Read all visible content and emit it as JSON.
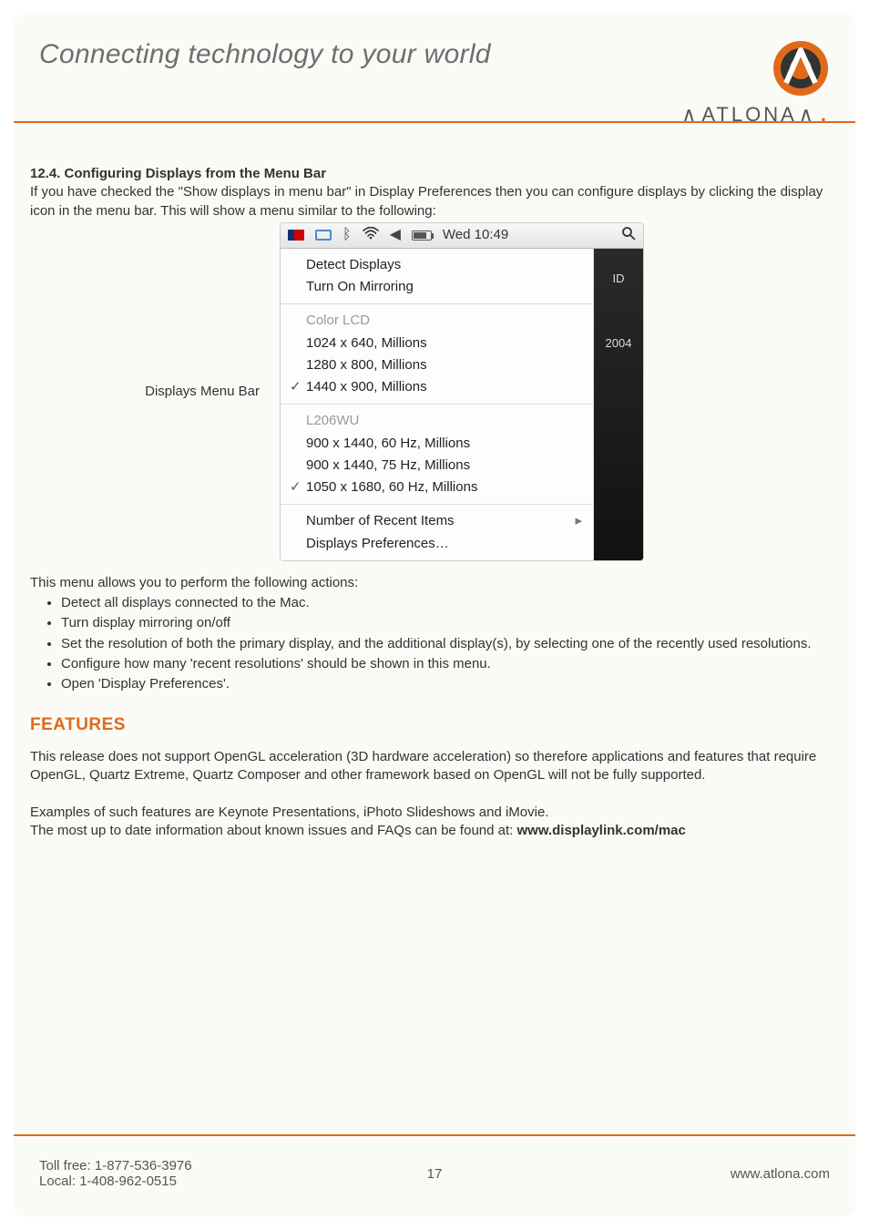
{
  "header": {
    "tagline": "Connecting technology to your world",
    "brand_word": "ATLONA",
    "brand_dot": "."
  },
  "section": {
    "number": "12.4.",
    "title": "Configuring Displays from the Menu Bar",
    "intro": "If you have checked the \"Show displays in menu bar\" in Display Preferences then you can configure displays by clicking the display icon in the menu bar. This will show a menu similar to the following:",
    "figure_caption": "Displays Menu Bar"
  },
  "screenshot": {
    "menubar": {
      "clock": "Wed 10:49"
    },
    "right_labels": {
      "a": "ID",
      "b": "2004"
    },
    "groups": {
      "actions": {
        "detect": "Detect Displays",
        "mirror": "Turn On Mirroring"
      },
      "display1": {
        "name": "Color LCD",
        "res1": "1024 x 640, Millions",
        "res2": "1280 x 800, Millions",
        "res3": "1440 x 900, Millions"
      },
      "display2": {
        "name": "L206WU",
        "res1": "900 x 1440, 60 Hz, Millions",
        "res2": "900 x 1440, 75 Hz, Millions",
        "res3": "1050 x 1680, 60 Hz, Millions"
      },
      "footer": {
        "recent": "Number of Recent Items",
        "prefs": "Displays Preferences…"
      }
    }
  },
  "after_figure": {
    "lead": "This menu allows you to perform the following actions:",
    "b1": "Detect all displays connected to the Mac.",
    "b2": "Turn display mirroring on/off",
    "b3": "Set the resolution of both the primary display, and the additional display(s), by selecting one of the recently used resolutions.",
    "b4": "Configure how many 'recent resolutions' should be shown in this menu.",
    "b5": "Open 'Display Preferences'."
  },
  "features": {
    "heading": "FEATURES",
    "p1": "This release does not support OpenGL acceleration (3D hardware acceleration) so therefore applications and features that require OpenGL, Quartz Extreme, Quartz Composer and other framework based on OpenGL will not be fully supported.",
    "p2": "Examples of such features are Keynote Presentations, iPhoto Slideshows and iMovie.",
    "p3a": "The most up to date information about known issues and FAQs can be found at: ",
    "p3b": "www.displaylink.com/mac"
  },
  "footer": {
    "tollfree": "Toll free: 1-877-536-3976",
    "local": "Local: 1-408-962-0515",
    "page": "17",
    "site": "www.atlona.com"
  }
}
